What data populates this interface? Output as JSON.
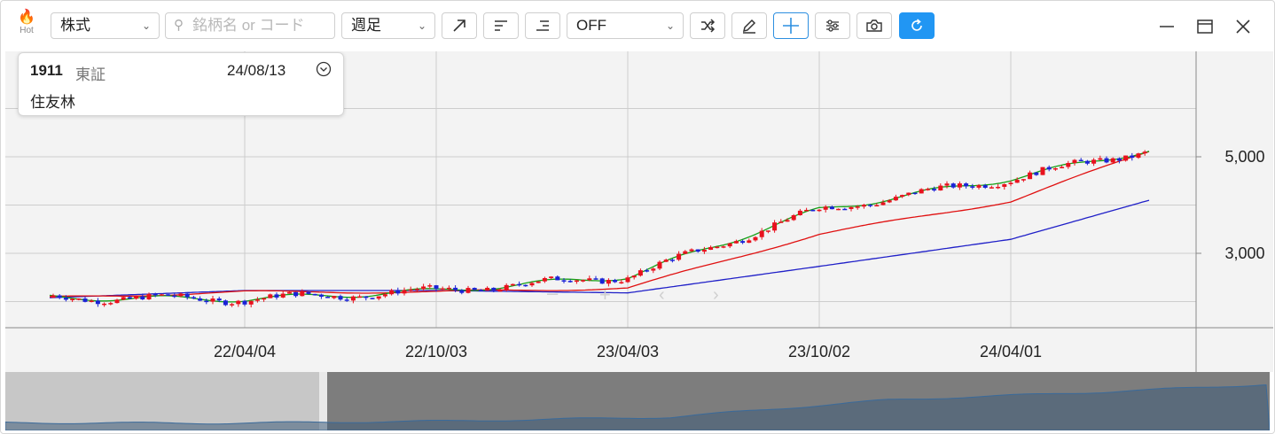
{
  "toolbar": {
    "hot_label": "Hot",
    "market_select": "株式",
    "search_placeholder": "銘柄名 or コード",
    "period_select": "週足",
    "indicator_select": "OFF",
    "icons": [
      "trend-line-icon",
      "align-left-icon",
      "align-right-icon",
      "shuffle-icon",
      "pencil-icon",
      "crosshair-icon",
      "sliders-icon",
      "camera-icon",
      "refresh-icon"
    ]
  },
  "window": {
    "icons": [
      "minimize-icon",
      "maximize-icon",
      "close-icon"
    ]
  },
  "info": {
    "code": "1911",
    "exchange": "東証",
    "date": "24/08/13",
    "name": "住友林"
  },
  "colors": {
    "up": "#e8121e",
    "down": "#1a22d6",
    "ma_short": "#15a015",
    "ma_mid": "#e01010",
    "ma_long": "#2020c8",
    "accent": "#2196f3"
  },
  "chart_data": {
    "type": "candlestick",
    "title": "",
    "xlabel": "",
    "ylabel": "",
    "x_ticks": [
      "22/04/04",
      "22/10/03",
      "23/04/03",
      "23/10/02",
      "24/04/01"
    ],
    "y_ticks": [
      3000,
      5000
    ],
    "ylim": [
      1750,
      7900
    ],
    "grid": true,
    "series": [
      {
        "x": [
          "21/09",
          "22/04/04",
          "22/10/03",
          "23/04/03",
          "23/10/02",
          "24/04/01",
          "24/08/13"
        ],
        "values": [
          2080,
          2050,
          2220,
          2520,
          3900,
          4550,
          5150
        ]
      },
      {
        "x": [
          "21/09",
          "22/04/04",
          "22/10/03",
          "23/04/03",
          "23/10/02",
          "24/04/01",
          "24/08/13"
        ],
        "values": [
          2080,
          2200,
          2200,
          2280,
          3400,
          4080,
          5130
        ]
      },
      {
        "x": [
          "21/09",
          "22/04/04",
          "22/10/03",
          "23/04/03",
          "23/10/02",
          "24/04/01",
          "24/08/13"
        ],
        "values": [
          2080,
          2230,
          2230,
          2180,
          2730,
          3290,
          4110
        ]
      }
    ]
  }
}
